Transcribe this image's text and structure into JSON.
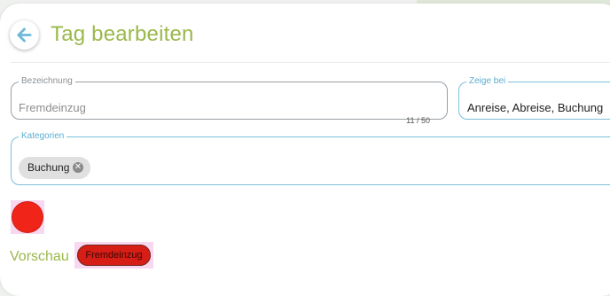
{
  "header": {
    "title": "Tag bearbeiten"
  },
  "form": {
    "bezeichnung": {
      "label": "Bezeichnung",
      "value": "Fremdeinzug",
      "counter": "11 / 50"
    },
    "zeige_bei": {
      "label": "Zeige bei",
      "value": "Anreise, Abreise, Buchung"
    },
    "kategorien": {
      "label": "Kategorien",
      "chips": [
        {
          "label": "Buchung"
        }
      ]
    },
    "color": "#f02418"
  },
  "preview": {
    "label": "Vorschau",
    "tag_text": "Fremdeinzug",
    "tag_color": "#d61d16"
  },
  "icons": {
    "back": "arrow-left-icon",
    "chip_remove": "close-circle-icon"
  },
  "colors": {
    "accent": "#9bb84a",
    "field_focus": "#7cc0d8"
  }
}
